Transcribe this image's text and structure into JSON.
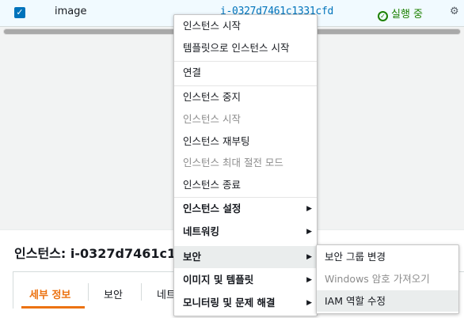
{
  "instance_row": {
    "name": "image",
    "instance_id": "i-0327d7461c1331cfd",
    "state": "실행 중",
    "state_icon": "check-circle-icon",
    "more_icon": "settings-icon"
  },
  "detail": {
    "title": "인스턴스: i-0327d7461c1",
    "tabs": [
      "세부 정보",
      "보안",
      "네트"
    ]
  },
  "context_menu": {
    "items": [
      {
        "label": "인스턴스 시작",
        "disabled": false
      },
      {
        "label": "템플릿으로 인스턴스 시작",
        "disabled": false
      },
      {
        "label": "연결",
        "disabled": false
      },
      {
        "label": "인스턴스 중지",
        "disabled": false
      },
      {
        "label": "인스턴스 시작",
        "disabled": true
      },
      {
        "label": "인스턴스 재부팅",
        "disabled": false
      },
      {
        "label": "인스턴스 최대 절전 모드",
        "disabled": true
      },
      {
        "label": "인스턴스 종료",
        "disabled": false
      },
      {
        "label": "인스턴스 설정",
        "submenu": true
      },
      {
        "label": "네트워킹",
        "submenu": true
      },
      {
        "label": "보안",
        "submenu": true,
        "selected": true
      },
      {
        "label": "이미지 및 템플릿",
        "submenu": true
      },
      {
        "label": "모니터링 및 문제 해결",
        "submenu": true
      }
    ]
  },
  "security_submenu": {
    "items": [
      {
        "label": "보안 그룹 변경",
        "disabled": false
      },
      {
        "label": "Windows 암호 가져오기",
        "disabled": true
      },
      {
        "label": "IAM 역할 수정",
        "disabled": false,
        "highlighted": true
      }
    ]
  }
}
